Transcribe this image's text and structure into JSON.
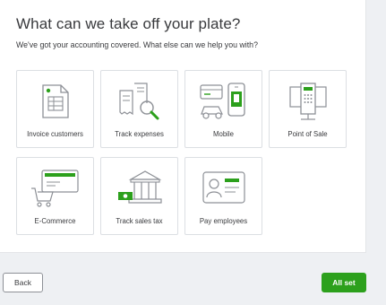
{
  "header": {
    "title": "What can we take off your plate?",
    "subtitle": "We've got your accounting covered. What else can we help you with?"
  },
  "options": [
    {
      "label": "Invoice customers",
      "icon": "invoice-icon"
    },
    {
      "label": "Track expenses",
      "icon": "receipt-magnifier-icon"
    },
    {
      "label": "Mobile",
      "icon": "mobile-icon"
    },
    {
      "label": "Point of Sale",
      "icon": "pos-terminal-icon"
    },
    {
      "label": "E-Commerce",
      "icon": "cart-card-icon"
    },
    {
      "label": "Track sales tax",
      "icon": "bank-building-icon"
    },
    {
      "label": "Pay employees",
      "icon": "id-badge-icon"
    }
  ],
  "footer": {
    "back_label": "Back",
    "next_label": "All set"
  },
  "colors": {
    "accent": "#2ca01c",
    "icon_gray": "#8d9096",
    "text": "#393a3d"
  }
}
